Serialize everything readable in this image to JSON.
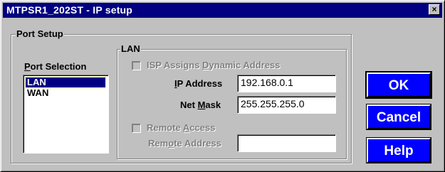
{
  "window": {
    "title": "MTPSR1_202ST - IP setup",
    "close_label": "×"
  },
  "port_setup": {
    "group_label": "Port Setup",
    "port_selection": {
      "label_pre": "",
      "label_accel": "P",
      "label_post": "ort Selection",
      "items": [
        {
          "label": "LAN",
          "selected": true
        },
        {
          "label": "WAN",
          "selected": false
        }
      ]
    },
    "lan": {
      "group_label": "LAN",
      "isp_dynamic": {
        "label_pre": "ISP Assigns ",
        "label_accel": "D",
        "label_post": "ynamic Address",
        "checked": false,
        "enabled": false
      },
      "ip_address": {
        "label_pre": "",
        "label_accel": "I",
        "label_post": "P Address",
        "value": "192.168.0.1"
      },
      "net_mask": {
        "label_pre": "Net ",
        "label_accel": "M",
        "label_post": "ask",
        "value": "255.255.255.0"
      },
      "remote_access": {
        "label_pre": "Remote ",
        "label_accel": "A",
        "label_post": "ccess",
        "checked": false,
        "enabled": false
      },
      "remote_address": {
        "label_pre": "Rem",
        "label_accel": "o",
        "label_post": "te Address",
        "value": ""
      }
    }
  },
  "buttons": {
    "ok": "OK",
    "cancel": "Cancel",
    "help": "Help"
  },
  "colors": {
    "titlebar": "#000080",
    "button_face": "#0000ff",
    "dialog_face": "#c0c0c0",
    "disabled_text": "#808080"
  }
}
